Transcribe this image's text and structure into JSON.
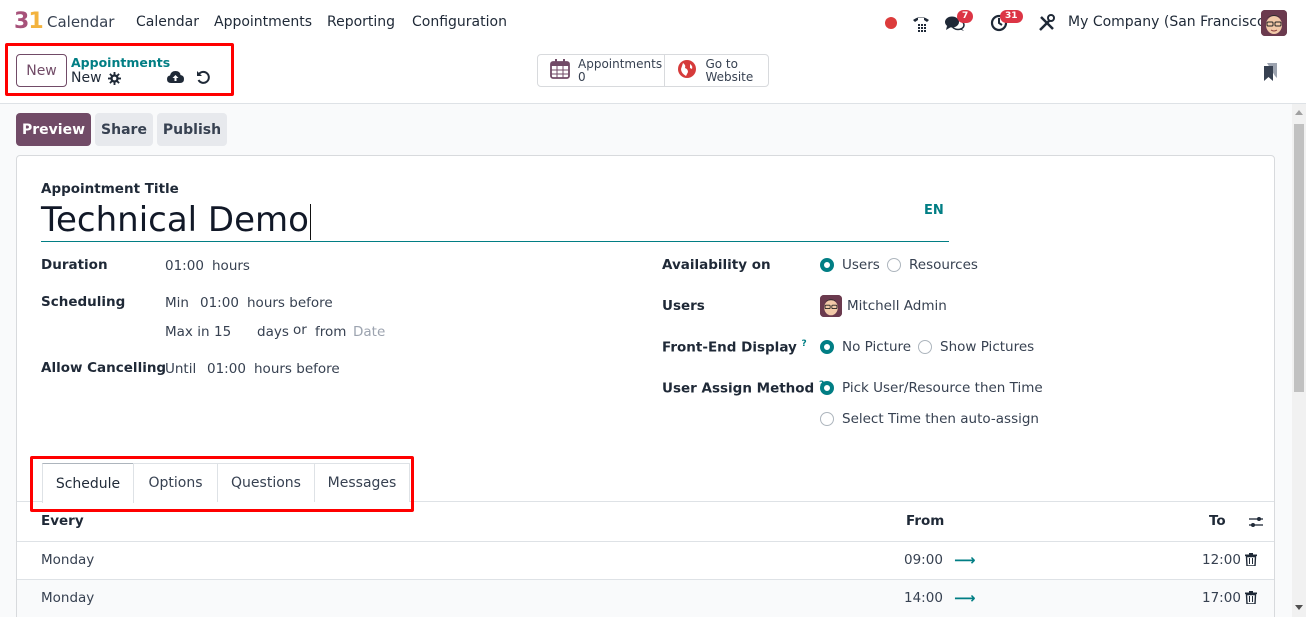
{
  "navbar": {
    "logo_digit_3": "3",
    "logo_digit_1": "1",
    "app_name": "Calendar",
    "menu": [
      "Calendar",
      "Appointments",
      "Reporting",
      "Configuration"
    ],
    "messages_badge": "7",
    "activities_badge": "31",
    "company": "My Company (San Francisco)",
    "icons": [
      "recording-dot",
      "phone-icon",
      "chat-icon",
      "clock-icon",
      "tools-icon",
      "user-avatar"
    ]
  },
  "control_panel": {
    "new_button": "New",
    "breadcrumb_parent": "Appointments",
    "breadcrumb_current": "New",
    "smart_buttons": [
      {
        "label": "Appointments",
        "value": "0",
        "icon": "calendar-icon"
      },
      {
        "label": "Go to",
        "value": "Website",
        "icon": "globe-icon"
      }
    ]
  },
  "actions": {
    "preview": "Preview",
    "share": "Share",
    "publish": "Publish"
  },
  "form": {
    "title_label": "Appointment Title",
    "title_value": "Technical Demo",
    "lang": "EN",
    "duration": {
      "label": "Duration",
      "value": "01:00",
      "unit": "hours"
    },
    "scheduling": {
      "label": "Scheduling",
      "min_prefix": "Min",
      "min_value": "01:00",
      "min_suffix": "hours before",
      "max_prefix": "Max in",
      "max_value": "15",
      "max_unit": "days",
      "or": "or",
      "from": "from",
      "date_placeholder": "Date"
    },
    "cancelling": {
      "label": "Allow Cancelling",
      "prefix": "Until",
      "value": "01:00",
      "suffix": "hours before"
    },
    "availability": {
      "label": "Availability on",
      "options": [
        "Users",
        "Resources"
      ],
      "selected": "Users"
    },
    "users": {
      "label": "Users",
      "value": "Mitchell Admin"
    },
    "front_end_display": {
      "label": "Front-End Display",
      "help": "?",
      "options": [
        "No Picture",
        "Show Pictures"
      ],
      "selected": "No Picture"
    },
    "assign_method": {
      "label": "User Assign Method",
      "help": "?",
      "options": [
        "Pick User/Resource then Time",
        "Select Time then auto-assign"
      ],
      "selected": "Pick User/Resource then Time"
    }
  },
  "tabs": [
    {
      "label": "Schedule",
      "active": true
    },
    {
      "label": "Options",
      "active": false
    },
    {
      "label": "Questions",
      "active": false
    },
    {
      "label": "Messages",
      "active": false
    }
  ],
  "schedule_table": {
    "columns": [
      "Every",
      "From",
      "To"
    ],
    "rows": [
      {
        "every": "Monday",
        "from": "09:00",
        "to": "12:00"
      },
      {
        "every": "Monday",
        "from": "14:00",
        "to": "17:00"
      }
    ]
  },
  "colors": {
    "brand": "#714b67",
    "accent": "#017e84",
    "badge": "#dc3545",
    "highlight_box": "#ff0000"
  }
}
